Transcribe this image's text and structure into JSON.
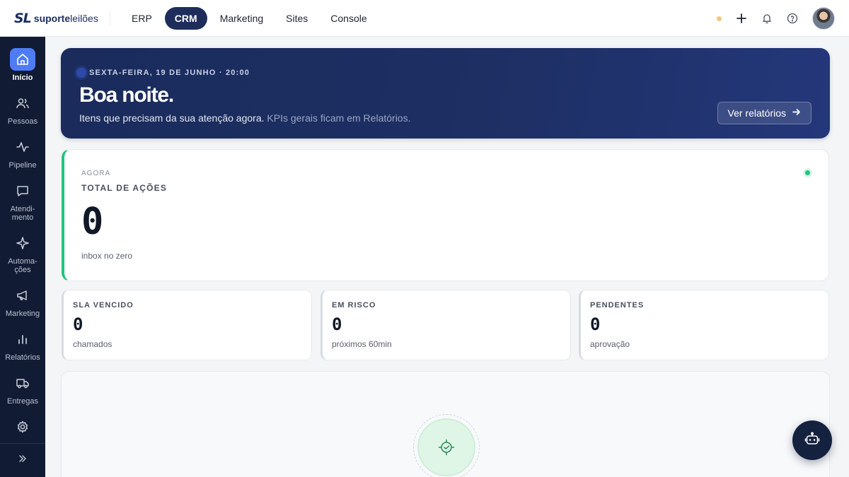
{
  "brand": {
    "mark": "SL",
    "bold": "suporte",
    "rest": "leilões"
  },
  "nav": [
    {
      "label": "ERP",
      "active": false
    },
    {
      "label": "CRM",
      "active": true
    },
    {
      "label": "Marketing",
      "active": false
    },
    {
      "label": "Sites",
      "active": false
    },
    {
      "label": "Console",
      "active": false
    }
  ],
  "topbar_icons": [
    "status-dot",
    "plus-icon",
    "bell-icon",
    "help-icon",
    "avatar"
  ],
  "sidebar": {
    "items": [
      {
        "label": "Início",
        "icon": "home-icon",
        "active": true
      },
      {
        "label": "Pessoas",
        "icon": "users-icon",
        "active": false
      },
      {
        "label": "Pipeline",
        "icon": "activity-icon",
        "active": false
      },
      {
        "label": "Atendi-\nmento",
        "icon": "message-icon",
        "active": false
      },
      {
        "label": "Automa-\nções",
        "icon": "sparkle-icon",
        "active": false
      },
      {
        "label": "Marketing",
        "icon": "megaphone-icon",
        "active": false
      },
      {
        "label": "Relatórios",
        "icon": "bar-chart-icon",
        "active": false
      },
      {
        "label": "Entregas",
        "icon": "truck-icon",
        "active": false
      },
      {
        "label": "",
        "icon": "gear-icon",
        "active": false
      }
    ],
    "collapse_icon": "chevrons-right-icon"
  },
  "hero": {
    "date": "SEXTA-FEIRA, 19 DE JUNHO · 20:00",
    "title": "Boa noite.",
    "subtitle": "Itens que precisam da sua atenção agora.",
    "subtitle_muted": "KPIs gerais ficam em Relatórios.",
    "button": "Ver relatórios"
  },
  "main_card": {
    "eyebrow": "AGORA",
    "label": "TOTAL DE AÇÕES",
    "value": "0",
    "caption": "inbox no zero"
  },
  "mini_cards": [
    {
      "label": "SLA VENCIDO",
      "value": "0",
      "caption": "chamados"
    },
    {
      "label": "EM RISCO",
      "value": "0",
      "caption": "próximos 60min"
    },
    {
      "label": "PENDENTES",
      "value": "0",
      "caption": "aprovação"
    }
  ],
  "colors": {
    "accent": "#1e2d5c",
    "sidebar": "#111b34",
    "active_icon": "#4f7cf6",
    "success": "#22c37e"
  }
}
